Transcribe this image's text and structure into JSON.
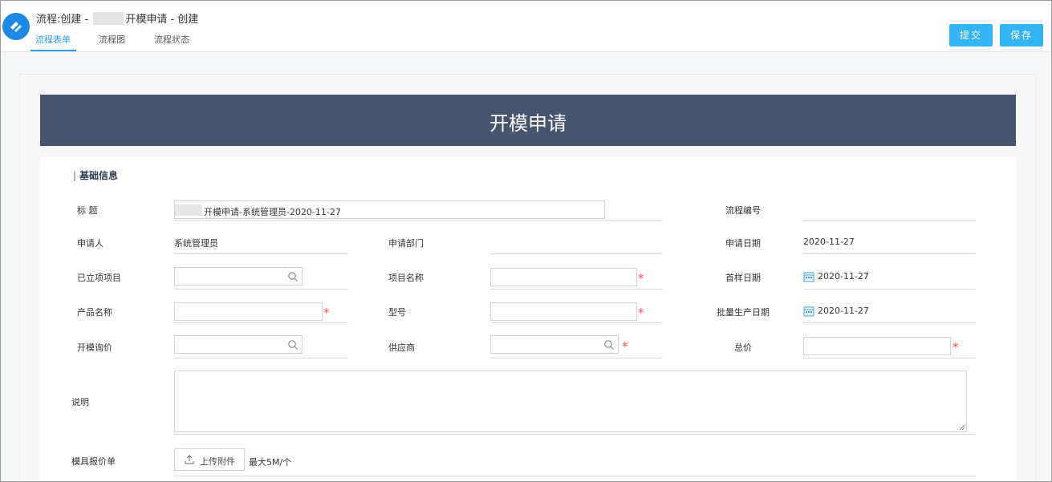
{
  "header": {
    "title_prefix": "流程:创建 - ",
    "title_suffix": "开模申请 - 创建",
    "tabs": [
      {
        "label": "流程表单",
        "active": true
      },
      {
        "label": "流程图",
        "active": false
      },
      {
        "label": "流程状态",
        "active": false
      }
    ],
    "buttons": {
      "submit": "提交",
      "save": "保存"
    }
  },
  "form": {
    "banner_title": "开模申请",
    "section_title": "基础信息",
    "fields": {
      "title_label": "标 题",
      "title_value": "开模申请-系统管理员-2020-11-27",
      "process_no_label": "流程编号",
      "applicant_label": "申请人",
      "applicant_value": "系统管理员",
      "dept_label": "申请部门",
      "apply_date_label": "申请日期",
      "apply_date_value": "2020-11-27",
      "project_label": "已立项项目",
      "project_name_label": "项目名称",
      "first_sample_label": "首样日期",
      "first_sample_value": "2020-11-27",
      "product_label": "产品名称",
      "model_label": "型号",
      "mass_prod_label": "批量生产日期",
      "mass_prod_value": "2020-11-27",
      "inquiry_label": "开模询价",
      "supplier_label": "供应商",
      "total_label": "总价",
      "desc_label": "说明",
      "quote_label": "模具报价单",
      "upload_label": "上传附件",
      "upload_limit": "最大5M/个"
    },
    "required_mark": "*"
  },
  "colors": {
    "accent": "#2a9ee8",
    "button": "#33b5f5",
    "banner": "#45566c",
    "required": "#ff4d4f"
  }
}
